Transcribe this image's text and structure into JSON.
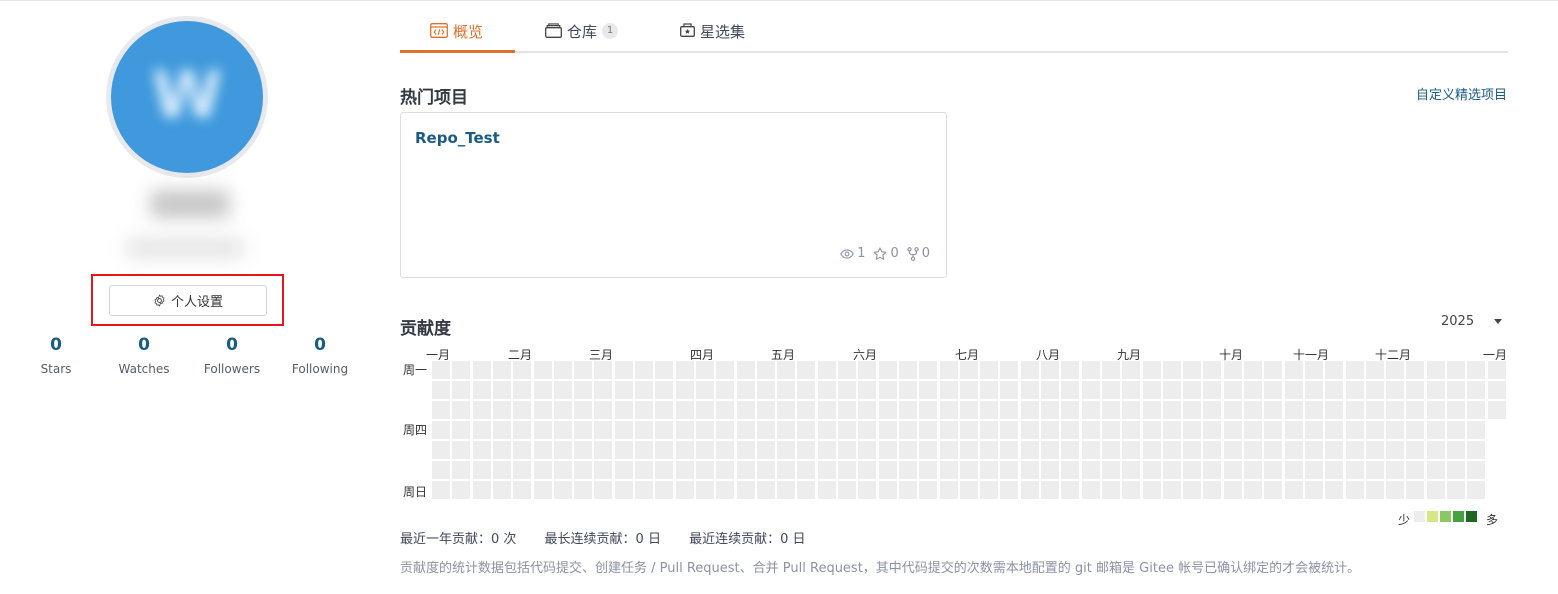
{
  "profile": {
    "avatar_letter": "W",
    "settings_button": "个人设置",
    "stats": [
      {
        "value": "0",
        "label": "Stars"
      },
      {
        "value": "0",
        "label": "Watches"
      },
      {
        "value": "0",
        "label": "Followers"
      },
      {
        "value": "0",
        "label": "Following"
      }
    ]
  },
  "tabs": [
    {
      "label": "概览",
      "active": true,
      "icon": "code-window-icon"
    },
    {
      "label": "仓库",
      "badge": "1",
      "icon": "repo-stack-icon"
    },
    {
      "label": "星选集",
      "icon": "collection-box-icon"
    }
  ],
  "popular": {
    "title": "热门项目",
    "custom_link": "自定义精选项目",
    "repo": {
      "name": "Repo_Test",
      "watches": "1",
      "stars": "0",
      "forks": "0"
    }
  },
  "contribution": {
    "title": "贡献度",
    "year": "2025",
    "months": [
      "一月",
      "二月",
      "三月",
      "四月",
      "五月",
      "六月",
      "七月",
      "八月",
      "九月",
      "十月",
      "十一月",
      "十二月",
      "一月"
    ],
    "days": [
      "周一",
      "周四",
      "周日"
    ],
    "legend_less": "少",
    "legend_more": "多",
    "legend_colors": [
      "#ededed",
      "#d6e685",
      "#8cc665",
      "#44a340",
      "#1e6823"
    ],
    "summary": {
      "year_total": "最近一年贡献：0 次",
      "longest_streak": "最长连续贡献：0 日",
      "current_streak": "最近连续贡献：0 日"
    },
    "note": "贡献度的统计数据包括代码提交、创建任务 / Pull Request、合并 Pull Request，其中代码提交的次数需本地配置的 git 邮箱是 Gitee 帐号已确认绑定的才会被统计。",
    "accent": "#e0712c",
    "link_color": "#1a5b84"
  }
}
